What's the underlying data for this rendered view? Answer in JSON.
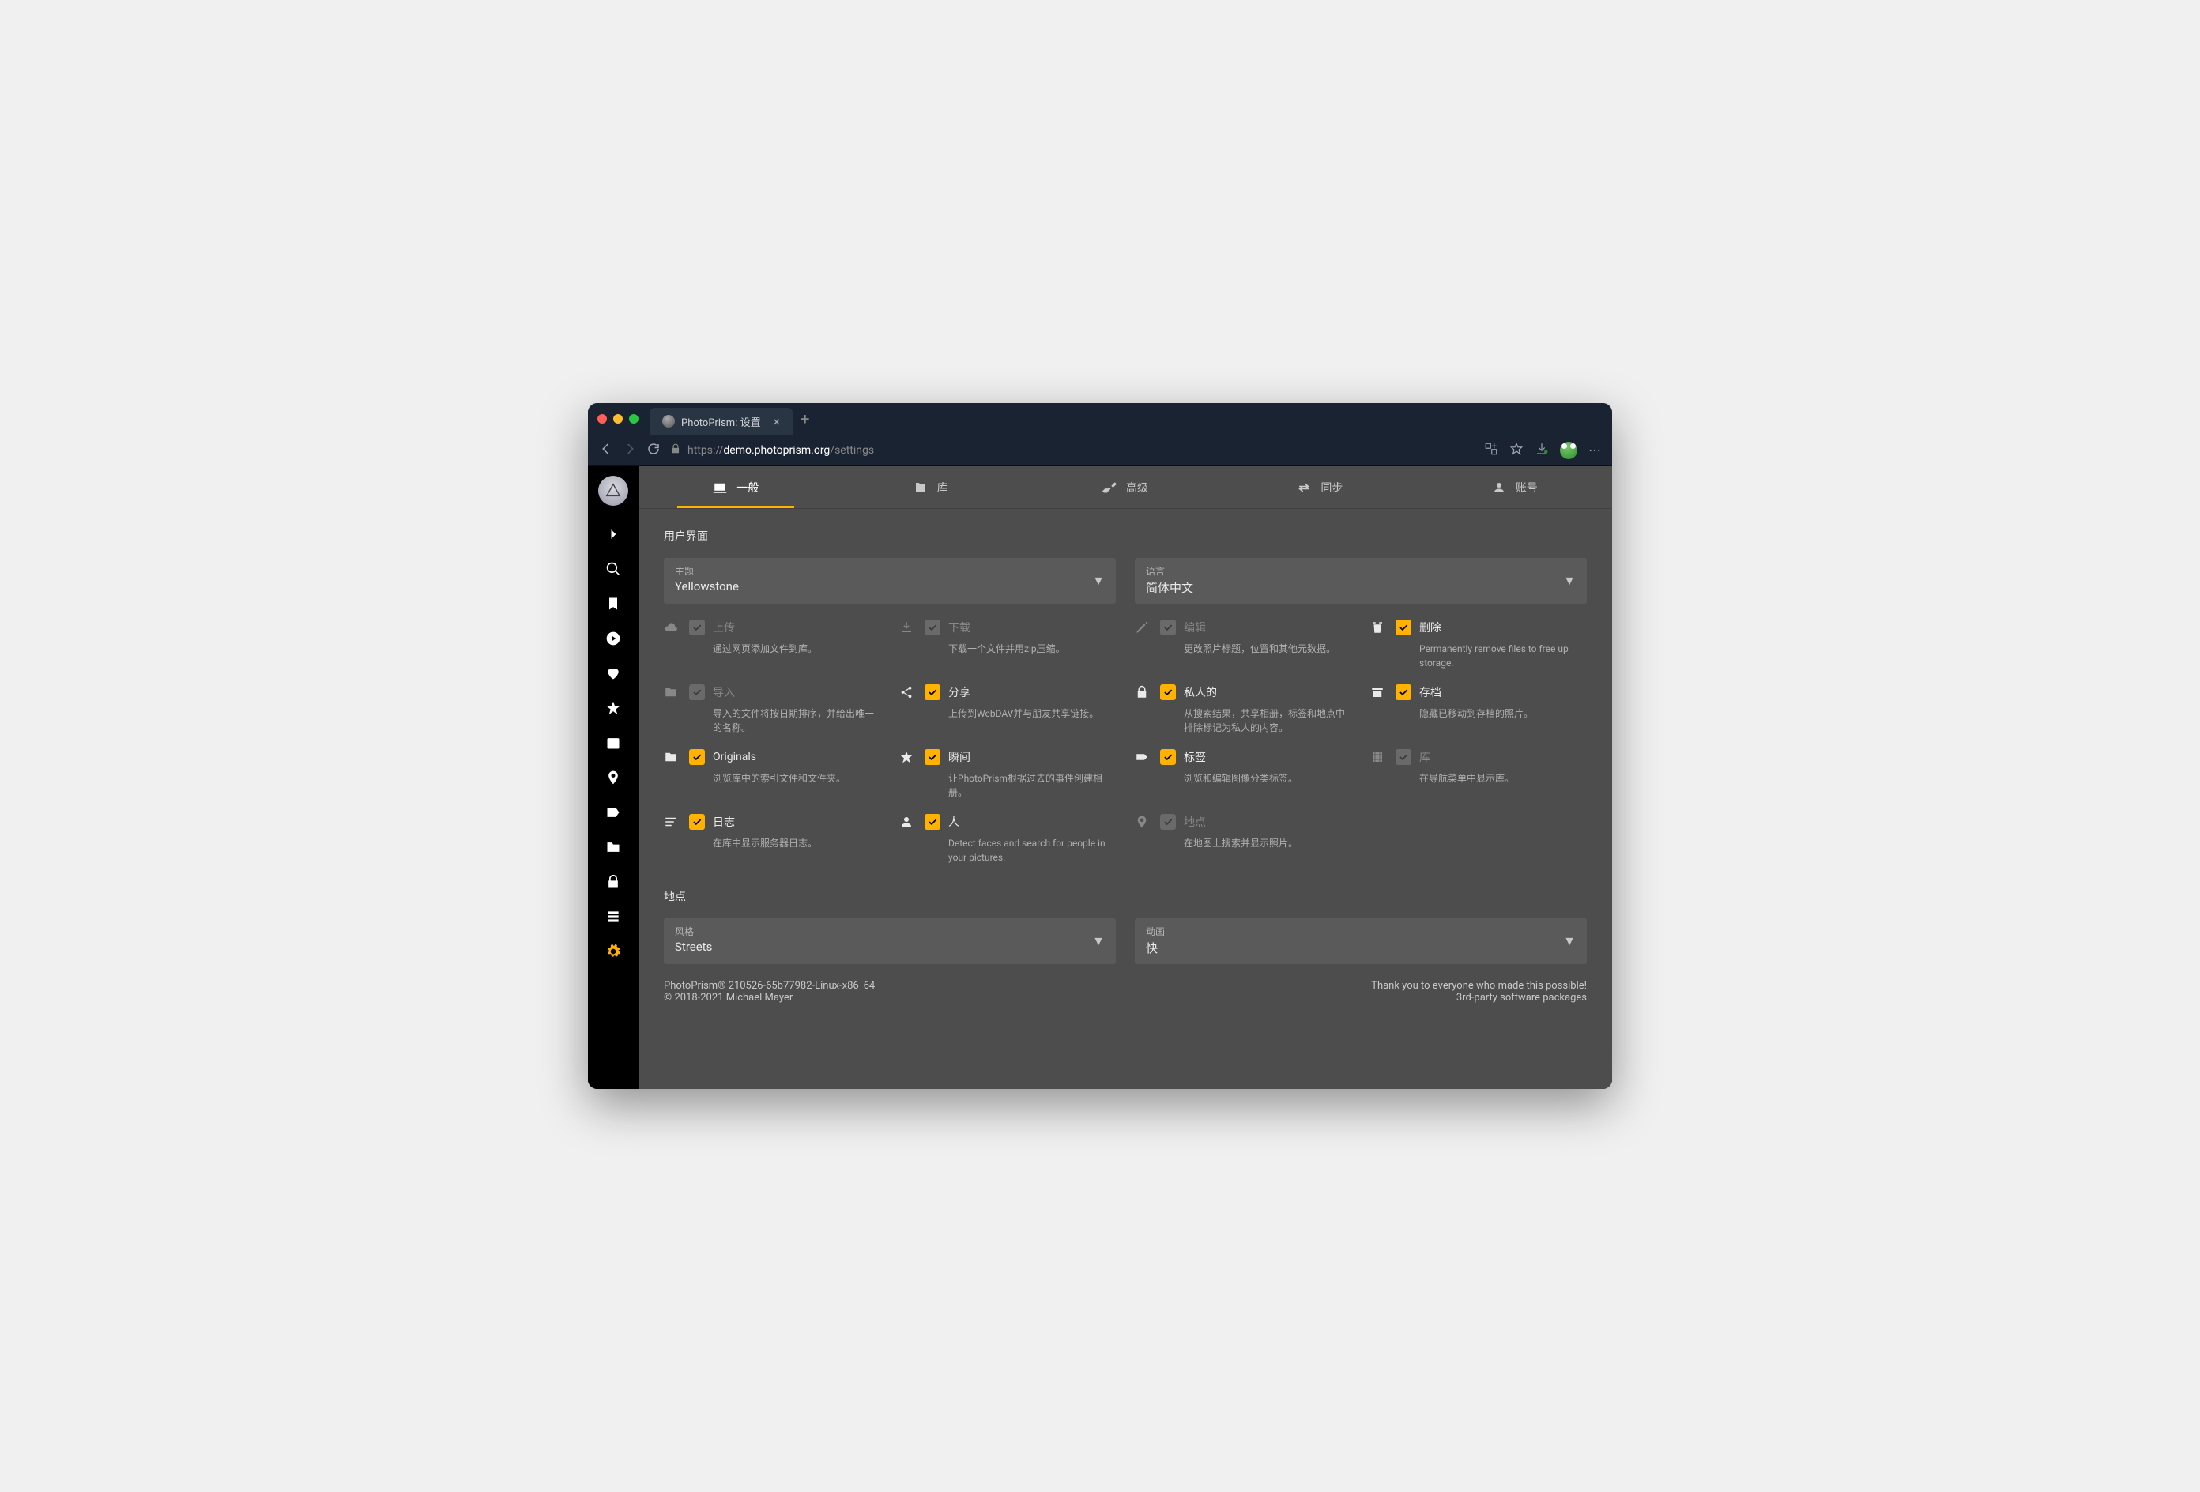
{
  "browser": {
    "tab_title": "PhotoPrism: 设置",
    "url_prefix": "https://",
    "url_host": "demo.photoprism.org",
    "url_path": "/settings"
  },
  "tabs": [
    {
      "label": "一般"
    },
    {
      "label": "库"
    },
    {
      "label": "高级"
    },
    {
      "label": "同步"
    },
    {
      "label": "账号"
    }
  ],
  "section_ui": "用户界面",
  "theme": {
    "label": "主题",
    "value": "Yellowstone"
  },
  "language": {
    "label": "语言",
    "value": "简体中文"
  },
  "options": {
    "upload": {
      "label": "上传",
      "desc": "通过网页添加文件到库。"
    },
    "download": {
      "label": "下载",
      "desc": "下载一个文件并用zip压缩。"
    },
    "edit": {
      "label": "编辑",
      "desc": "更改照片标题，位置和其他元数据。"
    },
    "delete": {
      "label": "删除",
      "desc": "Permanently remove files to free up storage."
    },
    "import": {
      "label": "导入",
      "desc": "导入的文件将按日期排序，并给出唯一的名称。"
    },
    "share": {
      "label": "分享",
      "desc": "上传到WebDAV并与朋友共享链接。"
    },
    "private": {
      "label": "私人的",
      "desc": "从搜索结果，共享相册，标签和地点中排除标记为私人的内容。"
    },
    "archive": {
      "label": "存档",
      "desc": "隐藏已移动到存档的照片。"
    },
    "originals": {
      "label": "Originals",
      "desc": "浏览库中的索引文件和文件夹。"
    },
    "moments": {
      "label": "瞬间",
      "desc": "让PhotoPrism根据过去的事件创建相册。"
    },
    "labels": {
      "label": "标签",
      "desc": "浏览和编辑图像分类标签。"
    },
    "library": {
      "label": "库",
      "desc": "在导航菜单中显示库。"
    },
    "logs": {
      "label": "日志",
      "desc": "在库中显示服务器日志。"
    },
    "people": {
      "label": "人",
      "desc": "Detect faces and search for people in your pictures."
    },
    "places": {
      "label": "地点",
      "desc": "在地图上搜索并显示照片。"
    }
  },
  "section_places": "地点",
  "style": {
    "label": "风格",
    "value": "Streets"
  },
  "animation": {
    "label": "动画",
    "value": "快"
  },
  "footer": {
    "version": "PhotoPrism® 210526-65b77982-Linux-x86_64",
    "copyright": "© 2018-2021 Michael Mayer",
    "thanks": "Thank you to everyone who made this possible!",
    "thirdparty": "3rd-party software packages"
  }
}
